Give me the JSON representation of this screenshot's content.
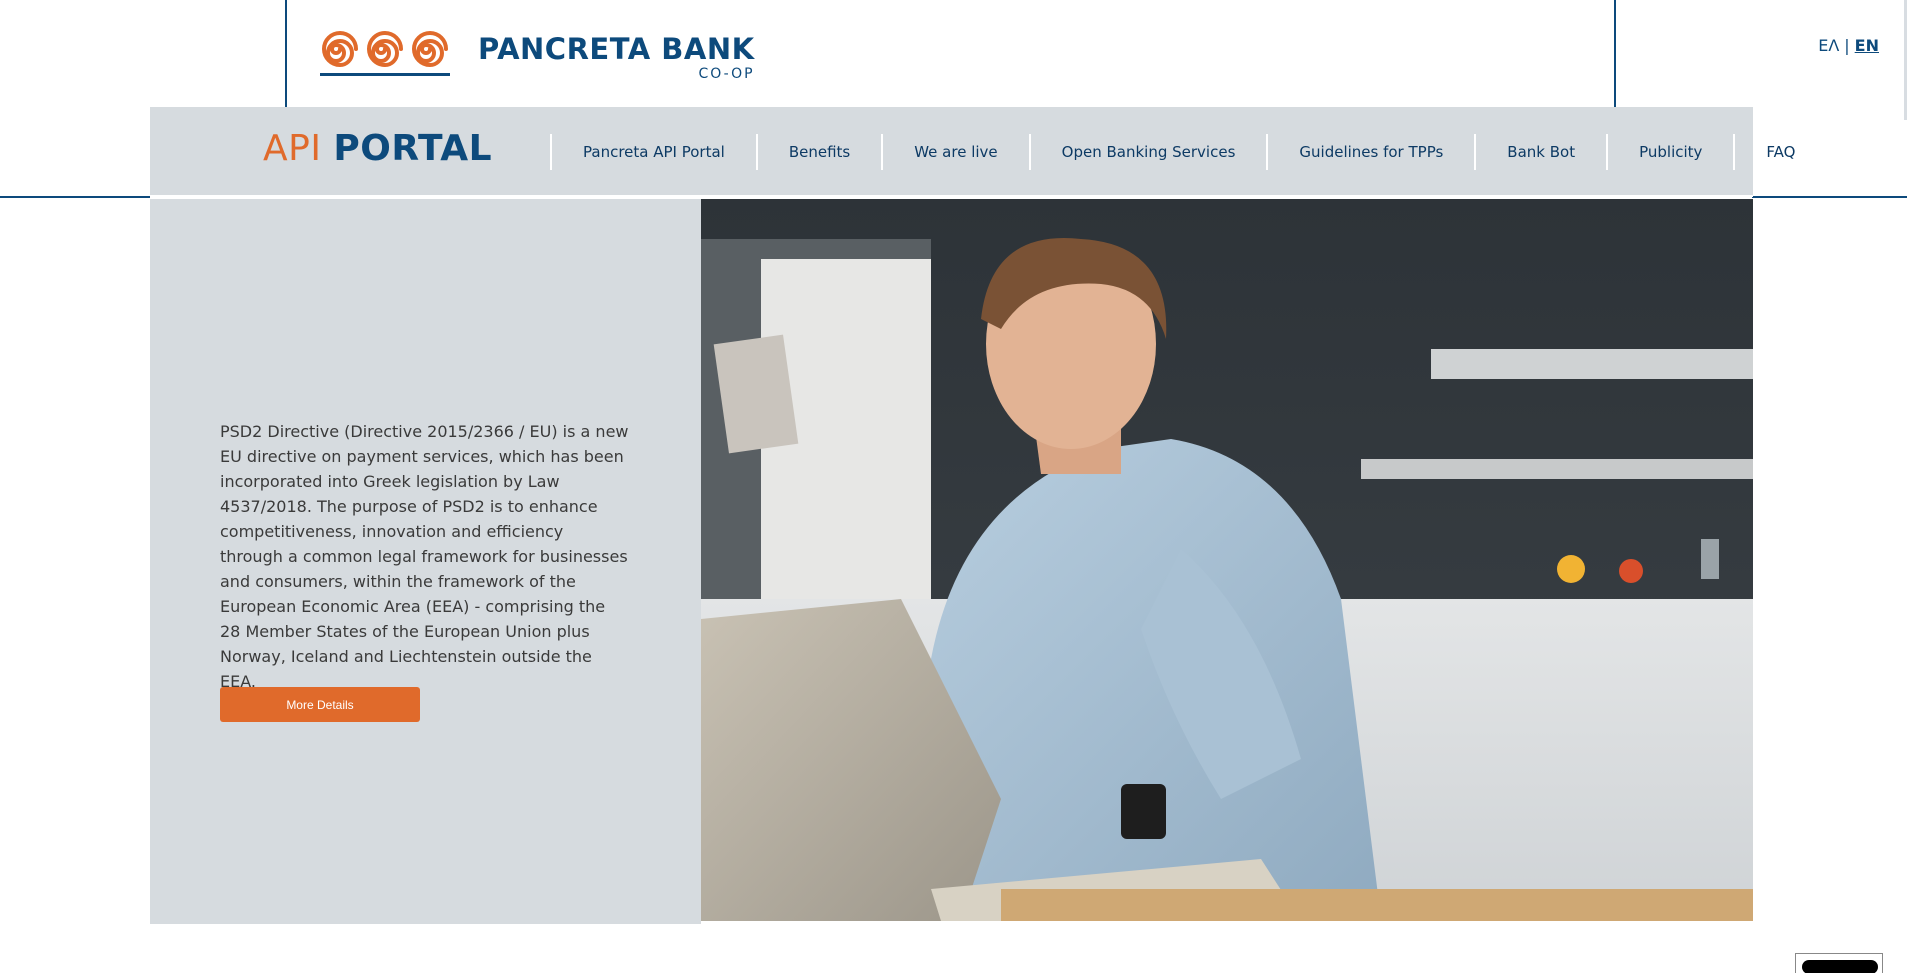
{
  "brand": {
    "name": "PANCRETA BANK",
    "sub": "CO-OP",
    "orange": "#e06a2b",
    "blue": "#0d4a7c"
  },
  "language": {
    "options": [
      "ΕΛ",
      "EN"
    ],
    "separator": "|",
    "active": "EN"
  },
  "nav": {
    "title_api": "API",
    "title_portal": "PORTAL",
    "items": [
      "Pancreta API Portal",
      "Benefits",
      "We are live",
      "Open Banking Services",
      "Guidelines for TPPs",
      "Bank Bot",
      "Publicity",
      "FAQ"
    ]
  },
  "hero": {
    "text": "PSD2 Directive (Directive 2015/2366 / EU) is a new EU directive on payment services, which has been incorporated into Greek legislation by Law 4537/2018. The purpose of PSD2 is to enhance competitiveness, innovation and efficiency through a common legal framework for businesses and consumers, within the framework of the European Economic Area (EEA) - comprising the 28 Member States of the European Union plus Norway, Iceland and Liechtenstein outside the EEA.",
    "button_label": "More Details"
  }
}
